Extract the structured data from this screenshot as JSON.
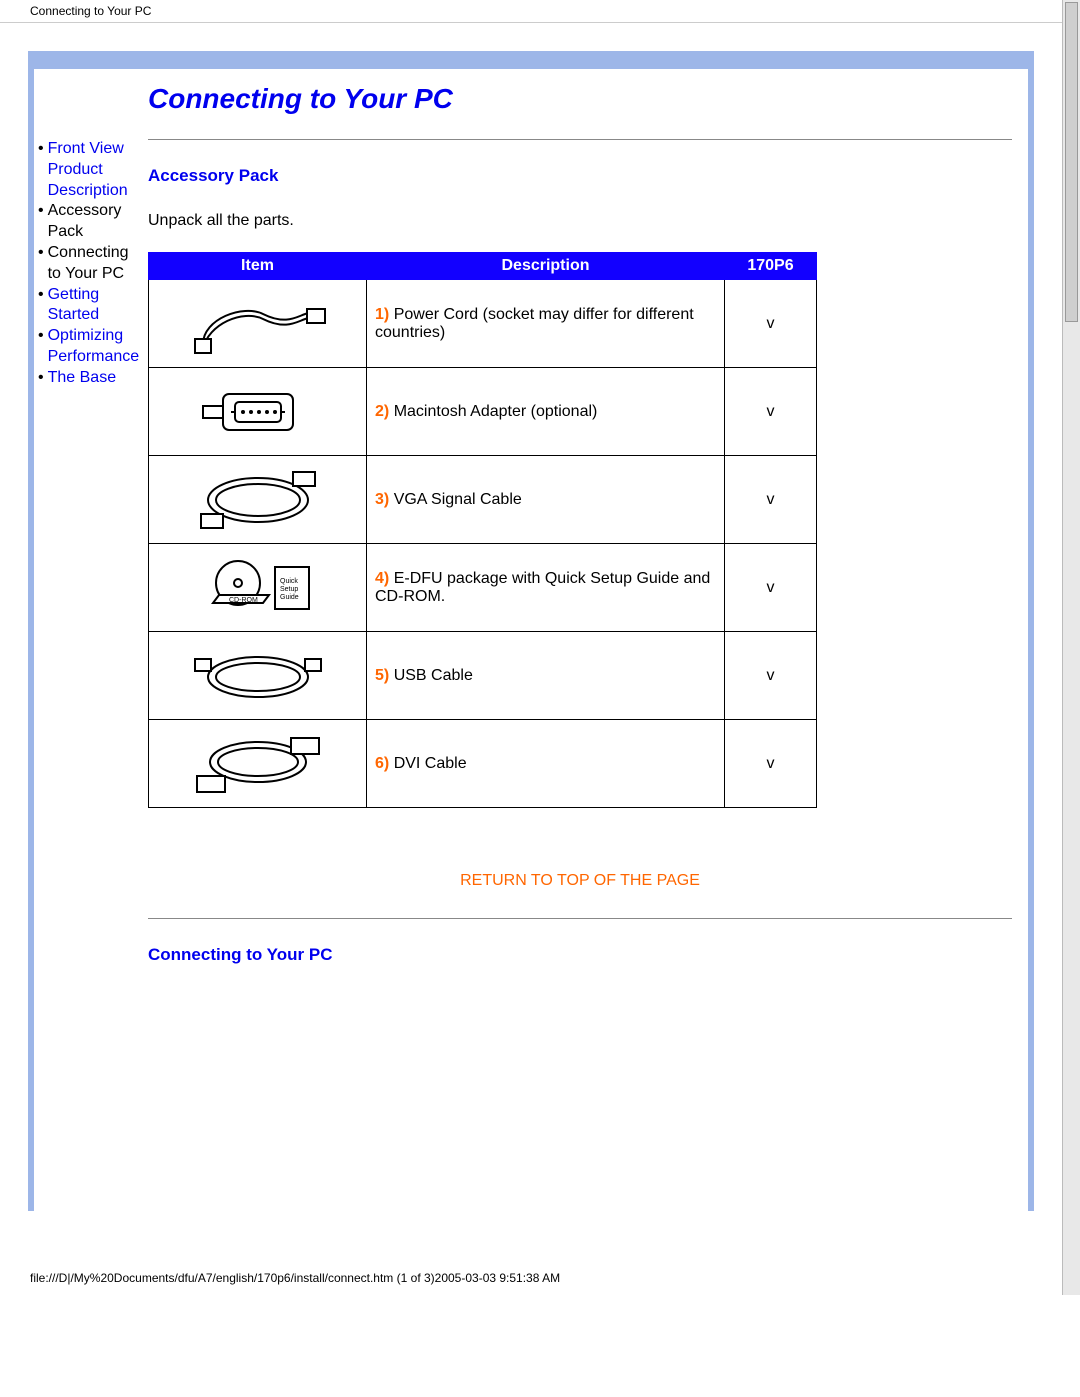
{
  "header_text": "Connecting to Your PC",
  "page_title": "Connecting to Your PC",
  "sidebar": [
    {
      "label": "Front View Product Description",
      "link": true
    },
    {
      "label": "Accessory Pack",
      "link": false
    },
    {
      "label": "Connecting to Your PC",
      "link": false
    },
    {
      "label": "Getting Started",
      "link": true
    },
    {
      "label": "Optimizing Performance",
      "link": true
    },
    {
      "label": "The Base",
      "link": true
    }
  ],
  "section1_heading": "Accessory Pack",
  "section1_intro": "Unpack all the parts.",
  "table": {
    "head": {
      "item": "Item",
      "desc": "Description",
      "model": "170P6"
    },
    "rows": [
      {
        "num": "1)",
        "text": "Power Cord (socket may differ for different countries)",
        "check": "v"
      },
      {
        "num": "2)",
        "text": "Macintosh Adapter (optional)",
        "check": "v"
      },
      {
        "num": "3)",
        "text": "VGA Signal Cable",
        "check": "v"
      },
      {
        "num": "4)",
        "text": "E-DFU package with Quick Setup Guide and CD-ROM.",
        "check": "v"
      },
      {
        "num": "5)",
        "text": "USB Cable",
        "check": "v"
      },
      {
        "num": "6)",
        "text": "DVI Cable",
        "check": "v"
      }
    ]
  },
  "return_link": "RETURN TO TOP OF THE PAGE",
  "section2_heading": "Connecting to Your PC",
  "footer_path": "file:///D|/My%20Documents/dfu/A7/english/170p6/install/connect.htm (1 of 3)2005-03-03 9:51:38 AM"
}
